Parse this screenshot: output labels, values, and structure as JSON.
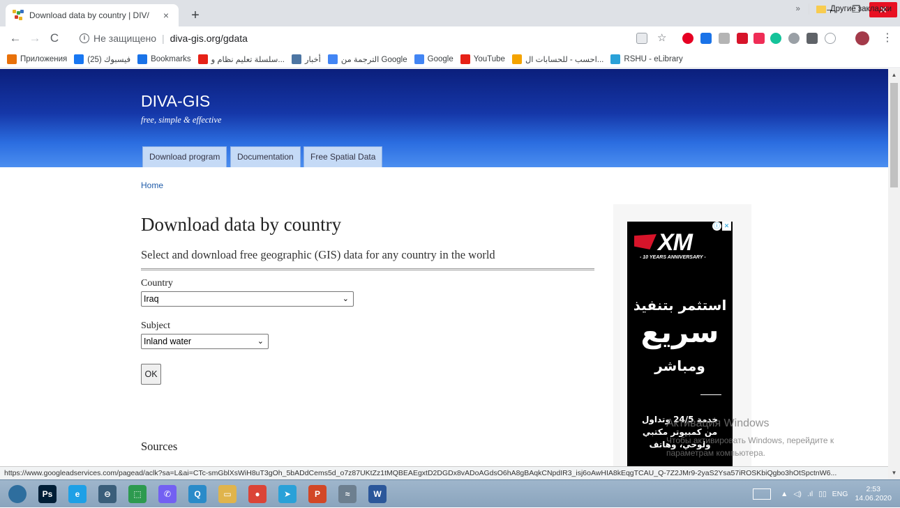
{
  "browser": {
    "tab_title": "Download data by country | DIV/",
    "tab_close": "×",
    "new_tab": "+",
    "window_controls": {
      "minimize": "–",
      "maximize": "❐",
      "close": "✕"
    },
    "nav": {
      "back": "←",
      "forward": "→",
      "reload": "C"
    },
    "security_info": "i",
    "security_label": "Не защищено",
    "url": "diva-gis.org/gdata",
    "bookmarks_bar": [
      {
        "label": "Приложения",
        "icon": "apps-grid-icon",
        "color": "#e8710a"
      },
      {
        "label": "(25) فيسبوك",
        "icon": "facebook-icon",
        "color": "#1877f2"
      },
      {
        "label": "Bookmarks",
        "icon": "star-icon",
        "color": "#1a73e8"
      },
      {
        "label": "سلسلة تعليم نظام و...",
        "icon": "youtube-icon",
        "color": "#e62117"
      },
      {
        "label": "أخبار",
        "icon": "vk-icon",
        "color": "#4c75a3"
      },
      {
        "label": "الترجمة من Google",
        "icon": "google-translate-icon",
        "color": "#4285f4"
      },
      {
        "label": "Google",
        "icon": "google-icon",
        "color": "#4285f4"
      },
      {
        "label": "YouTube",
        "icon": "youtube-icon",
        "color": "#e62117"
      },
      {
        "label": "احسب - للحسابات ال...",
        "icon": "orange-circle-icon",
        "color": "#f4a300"
      },
      {
        "label": "RSHU - eLibrary",
        "icon": "globe-icon",
        "color": "#2aa1d8"
      }
    ],
    "bookmarks_more": "»",
    "other_bookmarks": "Другие закладки"
  },
  "site": {
    "brand": "DIVA-GIS",
    "tagline": "free, simple & effective",
    "nav_tabs": [
      "Download program",
      "Documentation",
      "Free Spatial Data"
    ],
    "breadcrumb": "Home"
  },
  "main": {
    "title": "Download data by country",
    "subtitle": "Select and download free geographic (GIS) data for any country in the world",
    "country_label": "Country",
    "country_value": "Iraq",
    "subject_label": "Subject",
    "subject_value": "Inland water",
    "ok_label": "OK",
    "sources_heading": "Sources"
  },
  "ad": {
    "logo": "XM",
    "anniversary": "- 10 YEARS ANNIVERSARY -",
    "line1": "استثمر بتنفيذ",
    "line2": "سريع",
    "line3": "ومباشر",
    "line4": "خدمة 24/5 وتداول",
    "line5": "من كمبيوتر مكتبي",
    "line6": "ولوحي، وهاتف",
    "info_icon": "ⓘ",
    "close_icon": "✕"
  },
  "watermark": {
    "line1": "Активация Windows",
    "line2": "Чтобы активировать Windows, перейдите к",
    "line3": "параметрам компьютера."
  },
  "status_url": "https://www.googleadservices.com/pagead/aclk?sa=L&ai=CTc-smGblXsWiH8uT3gOh_5bADdCems5d_o7z87UKtZz1tMQBEAEgxtD2DGDx8vADoAGdsO6hA8gBAqkCNpdIR3_isj6oAwHIA8kEqgTCAU_Q-7Z2JMr9-2yaS2Ysa57iROSKbiQgbo3hOtSpctnW6...",
  "taskbar": {
    "apps": [
      {
        "name": "start-button",
        "glyph": "",
        "color": "#2e6e9e"
      },
      {
        "name": "photoshop",
        "glyph": "Ps",
        "color": "#001e36"
      },
      {
        "name": "internet-explorer",
        "glyph": "e",
        "color": "#1ea0e6"
      },
      {
        "name": "opera",
        "glyph": "⊖",
        "color": "#3a5e7a"
      },
      {
        "name": "store",
        "glyph": "⬚",
        "color": "#2d9a4f"
      },
      {
        "name": "viber",
        "glyph": "✆",
        "color": "#7360f2"
      },
      {
        "name": "search-app",
        "glyph": "Q",
        "color": "#2a8bc9"
      },
      {
        "name": "file-explorer",
        "glyph": "▭",
        "color": "#e0b44c"
      },
      {
        "name": "chrome",
        "glyph": "●",
        "color": "#db4437"
      },
      {
        "name": "telegram",
        "glyph": "➤",
        "color": "#2aa1d8"
      },
      {
        "name": "powerpoint",
        "glyph": "P",
        "color": "#d24726"
      },
      {
        "name": "satellite-app",
        "glyph": "≈",
        "color": "#6d7f8f"
      },
      {
        "name": "word",
        "glyph": "W",
        "color": "#2b579a"
      }
    ],
    "language": "ENG",
    "time": "2:53",
    "date": "14.06.2020"
  }
}
